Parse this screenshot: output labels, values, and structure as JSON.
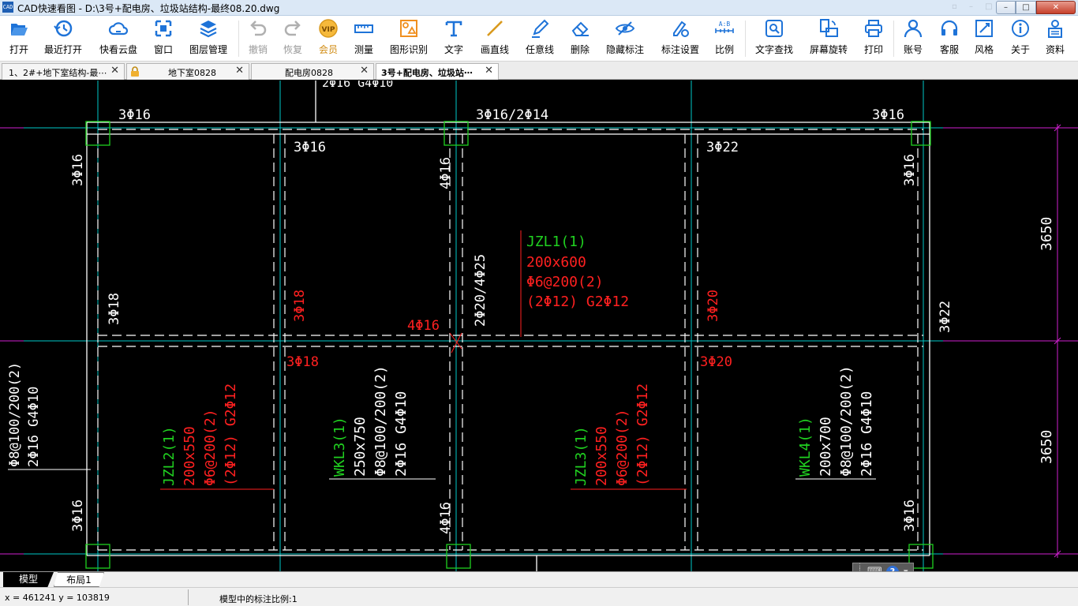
{
  "window": {
    "title": "CAD快速看图 - D:\\3号+配电房、垃圾站结构-最终08.20.dwg",
    "app_icon_text": "CAD",
    "controls": {
      "minimize": "–",
      "maximize": "□",
      "close": "✕"
    },
    "ghost_controls": "▫ – □"
  },
  "toolbar": {
    "items": [
      {
        "id": "open",
        "label": "打开",
        "icon": "folder-open-icon",
        "enabled": true
      },
      {
        "id": "recent",
        "label": "最近打开",
        "icon": "history-icon",
        "enabled": true
      },
      {
        "id": "cloud",
        "label": "快看云盘",
        "icon": "cloud-icon",
        "enabled": true
      },
      {
        "id": "window",
        "label": "窗口",
        "icon": "window-icon",
        "enabled": true
      },
      {
        "id": "layers",
        "label": "图层管理",
        "icon": "layers-icon",
        "enabled": true
      },
      {
        "id": "undo",
        "label": "撤销",
        "icon": "undo-icon",
        "enabled": false
      },
      {
        "id": "redo",
        "label": "恢复",
        "icon": "redo-icon",
        "enabled": false
      },
      {
        "id": "vip",
        "label": "会员",
        "icon": "vip-icon",
        "enabled": true
      },
      {
        "id": "measure",
        "label": "测量",
        "icon": "ruler-icon",
        "enabled": true
      },
      {
        "id": "shape-recog",
        "label": "图形识别",
        "icon": "shape-recognition-icon",
        "enabled": true
      },
      {
        "id": "text",
        "label": "文字",
        "icon": "text-icon",
        "enabled": true
      },
      {
        "id": "line",
        "label": "画直线",
        "icon": "line-icon",
        "enabled": true
      },
      {
        "id": "freeline",
        "label": "任意线",
        "icon": "pen-icon",
        "enabled": true
      },
      {
        "id": "erase",
        "label": "删除",
        "icon": "eraser-icon",
        "enabled": true
      },
      {
        "id": "hide-annot",
        "label": "隐藏标注",
        "icon": "eye-hidden-icon",
        "enabled": true
      },
      {
        "id": "annot-settings",
        "label": "标注设置",
        "icon": "annotation-settings-icon",
        "enabled": true
      },
      {
        "id": "scale",
        "label": "比例",
        "icon": "scale-icon",
        "enabled": true
      },
      {
        "id": "text-search",
        "label": "文字查找",
        "icon": "text-search-icon",
        "enabled": true
      },
      {
        "id": "rotate",
        "label": "屏幕旋转",
        "icon": "screen-rotate-icon",
        "enabled": true
      },
      {
        "id": "print",
        "label": "打印",
        "icon": "printer-icon",
        "enabled": true
      },
      {
        "id": "account",
        "label": "账号",
        "icon": "user-icon",
        "enabled": true
      },
      {
        "id": "support",
        "label": "客服",
        "icon": "headset-icon",
        "enabled": true
      },
      {
        "id": "style",
        "label": "风格",
        "icon": "style-icon",
        "enabled": true
      },
      {
        "id": "about",
        "label": "关于",
        "icon": "info-icon",
        "enabled": true
      },
      {
        "id": "docs",
        "label": "资料",
        "icon": "documents-icon",
        "enabled": true
      }
    ],
    "icon_color": "#1e73d8",
    "disabled_color": "#b0b0b0",
    "vip_color": "#d99a1e"
  },
  "tabs": [
    {
      "label": "1、2#+地下室结构-最⋯",
      "active": false,
      "locked": false,
      "close": "✕"
    },
    {
      "label": "地下室0828",
      "active": false,
      "locked": true,
      "close": "✕"
    },
    {
      "label": "配电房0828",
      "active": false,
      "locked": false,
      "close": "✕"
    },
    {
      "label": "3号+配电房、垃圾站⋯",
      "active": true,
      "locked": false,
      "close": "✕"
    }
  ],
  "drawing": {
    "colors": {
      "beam": "#ffffff",
      "axis": "#00d0d0",
      "red": "#ff2020",
      "green": "#20d020",
      "dim": "#d020d0",
      "column": "#20d020"
    },
    "dims": [
      "3650",
      "3650"
    ],
    "top_clip": "2Φ16 G4Φ10",
    "labels_white": [
      "3Φ16",
      "3Φ16/2Φ14",
      "3Φ16",
      "3Φ16",
      "3Φ22",
      "3Φ16",
      "4Φ16",
      "3Φ16",
      "3Φ18",
      "2Φ20/4Φ25",
      "3Φ22",
      "3Φ16",
      "4Φ16",
      "3Φ16"
    ],
    "labels_red": [
      "4Φ16",
      "3Φ18",
      "3Φ20",
      "3Φ18",
      "3Φ20"
    ],
    "jzl1": {
      "name": "JZL1(1)",
      "size": "200x600",
      "stirrup": "Φ6@200(2)",
      "bars": "(2Φ12) G2Φ12"
    },
    "jzl2": {
      "name": "JZL2(1)",
      "size": "200x550",
      "stirrup": "Φ6@200(2)",
      "bars": "(2Φ12) G2Φ12"
    },
    "jzl3": {
      "name": "JZL3(1)",
      "size": "200x550",
      "stirrup": "Φ6@200(2)",
      "bars": "(2Φ12) G2Φ12"
    },
    "wkl3": {
      "name": "WKL3(1)",
      "size": "250x750",
      "stirrup": "Φ8@100/200(2)",
      "bars": "2Φ16 G4Φ10"
    },
    "wkl4": {
      "name": "WKL4(1)",
      "size": "200x700",
      "stirrup": "Φ8@100/200(2)",
      "bars": "2Φ16 G4Φ10"
    },
    "left_edge": {
      "stirrup": "Φ8@100/200(2)",
      "bars": "2Φ16 G4Φ10"
    }
  },
  "layout_tabs": [
    {
      "label": "模型",
      "active": true
    },
    {
      "label": "布局1",
      "active": false
    }
  ],
  "viewport_widget": {
    "keyboard": "⌨",
    "help": "?",
    "menu": "▾"
  },
  "status": {
    "coords": "x = 461241  y = 103819",
    "scale_text": "模型中的标注比例:1"
  }
}
